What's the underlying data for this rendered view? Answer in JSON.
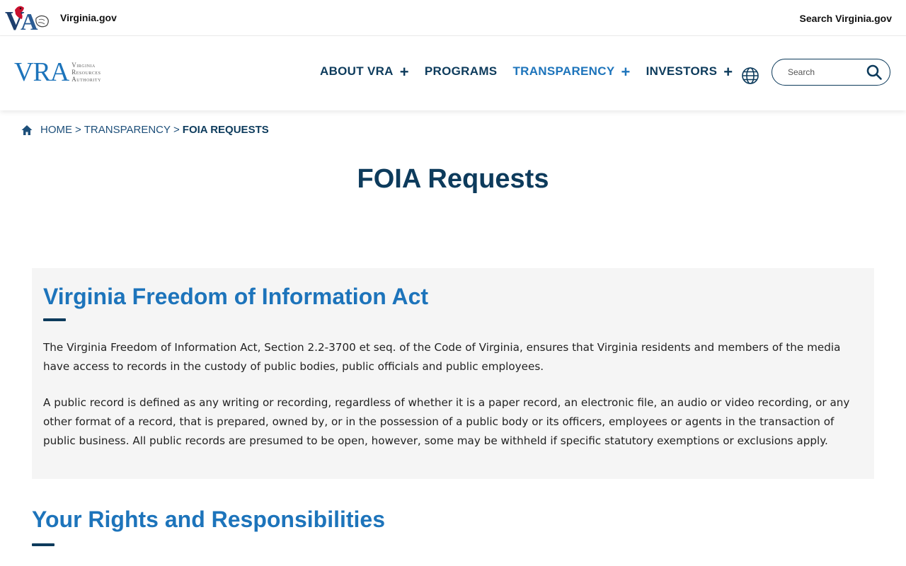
{
  "utility": {
    "va_label": "Virginia.gov",
    "search_label": "Search Virginia.gov",
    "logo_text": "VA"
  },
  "header": {
    "logo": {
      "mark": "VRA",
      "line1": "Virginia",
      "line2": "Resources",
      "line3": "Authority"
    },
    "nav": [
      {
        "label": "ABOUT VRA",
        "expand": "+"
      },
      {
        "label": "PROGRAMS"
      },
      {
        "label": "TRANSPARENCY",
        "expand": "+"
      },
      {
        "label": "INVESTORS",
        "expand": "+"
      }
    ],
    "globe_icon": "globe-icon",
    "search": {
      "placeholder": "Search",
      "icon": "search-icon"
    }
  },
  "breadcrumb": {
    "home": "HOME",
    "sep": ">",
    "parent": "TRANSPARENCY",
    "current": "FOIA REQUESTS"
  },
  "page": {
    "title": "FOIA Requests"
  },
  "panel": {
    "heading": "Virginia Freedom of Information Act",
    "paragraphs": [
      "The Virginia Freedom of Information Act, Section 2.2-3700 et seq. of the Code of Virginia, ensures that Virginia residents and members of the media have access to records in the custody of public bodies, public officials and public employees.",
      "A public record is defined as any writing or recording, regardless of whether it is a paper record, an electronic file, an audio or video recording, or any other format of a record, that is prepared, owned by, or in the possession of a public body or its officers, employees or agents in the transaction of public business. All public records are presumed to be open, however, some may be withheld if specific statutory exemptions or exclusions apply."
    ]
  },
  "section": {
    "heading": "Your Rights and Responsibilities"
  },
  "colors": {
    "navy": "#0d3b5c",
    "blue": "#1d74bb",
    "panel_bg": "#f5f5f5"
  }
}
